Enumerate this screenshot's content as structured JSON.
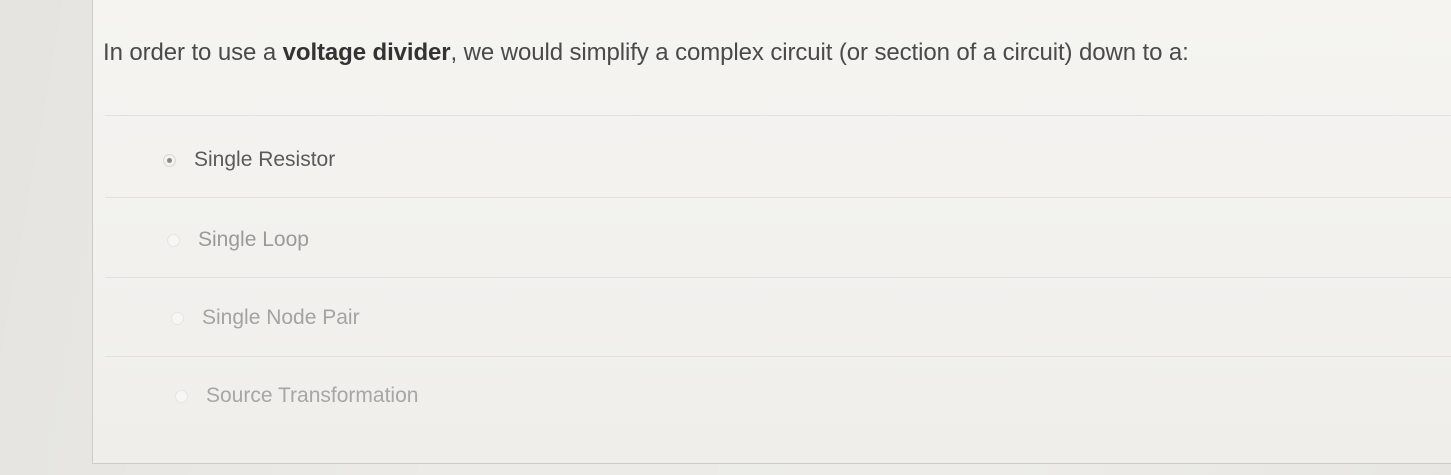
{
  "question": {
    "text_before": "In order to use a ",
    "bold_term": "voltage divider",
    "text_after": ", we would simplify a complex circuit (or section of a circuit) down to a:"
  },
  "options": [
    {
      "label": "Single Resistor",
      "selected": true
    },
    {
      "label": "Single Loop",
      "selected": false
    },
    {
      "label": "Single Node Pair",
      "selected": false
    },
    {
      "label": "Source Transformation",
      "selected": false
    }
  ],
  "colors": {
    "card_background": "#f3f2ef",
    "question_text": "#4a4a4a",
    "selected_label": "#5a5a5a",
    "unselected_label": "#a0a0a0"
  }
}
